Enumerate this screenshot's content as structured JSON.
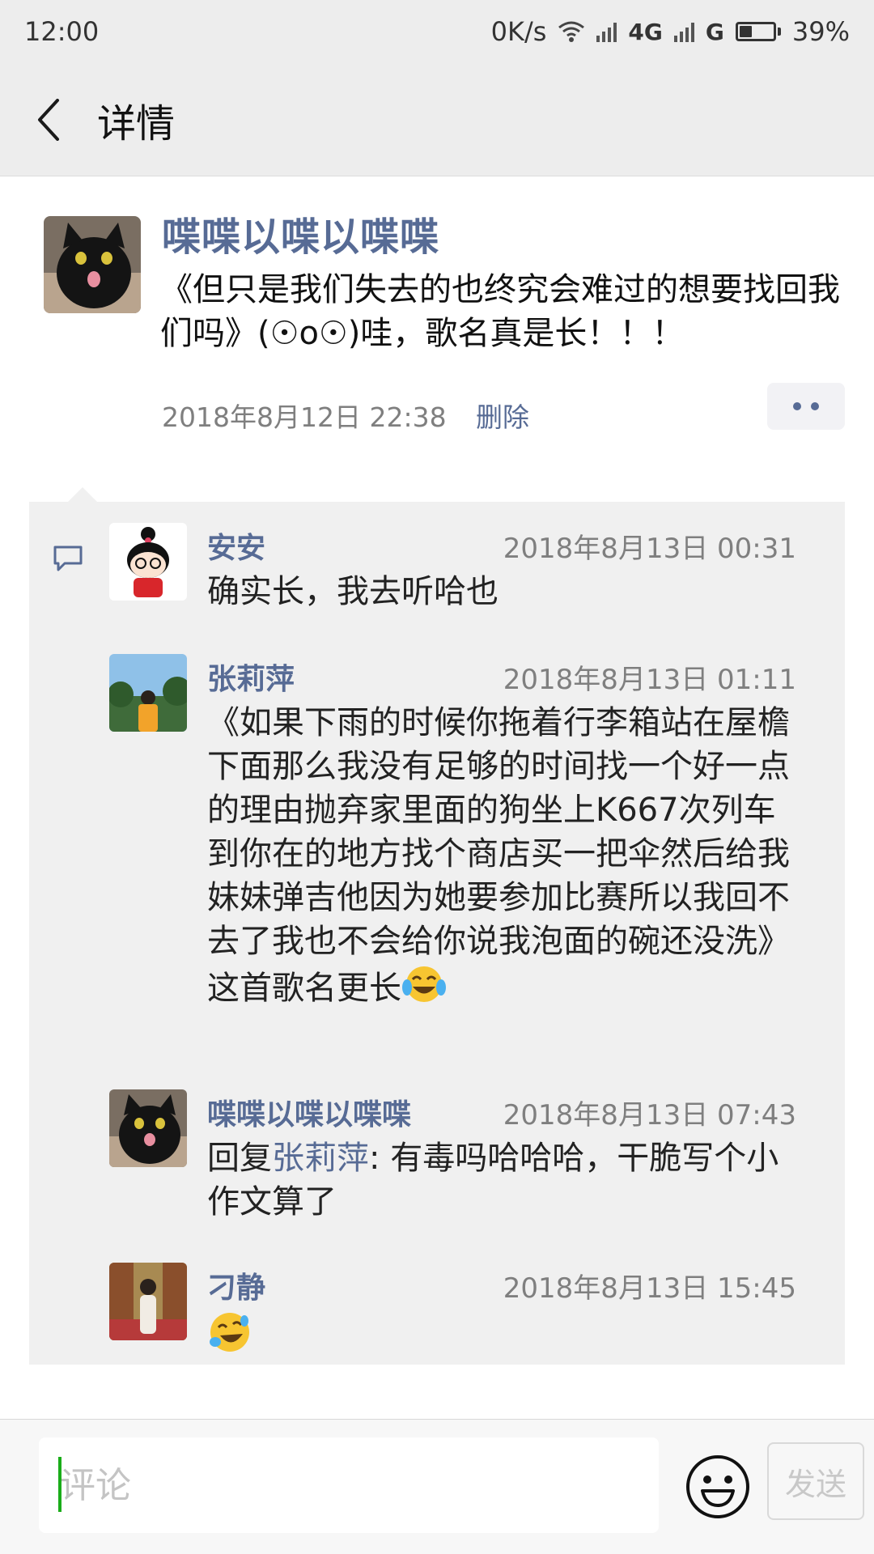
{
  "status": {
    "time": "12:00",
    "speed": "0K/s",
    "network1": "4G",
    "network2": "G",
    "battery": "39%",
    "battery_level": 0.39
  },
  "nav": {
    "title": "详情",
    "back_icon": "chevron-left-icon"
  },
  "post": {
    "author": "喋喋以喋以喋喋",
    "text": "《但只是我们失去的也终究会难过的想要找回我们吗》(☉o☉)哇，歌名真是长！！！",
    "time": "2018年8月12日 22:38",
    "delete_label": "删除"
  },
  "comments": [
    {
      "name": "安安",
      "time": "2018年8月13日 00:31",
      "text": "确实长，我去听哈也"
    },
    {
      "name": "张莉萍",
      "time": "2018年8月13日 01:11",
      "text": "《如果下雨的时候你拖着行李箱站在屋檐下面那么我没有足够的时间找一个好一点的理由抛弃家里面的狗坐上K667次列车到你在的地方找个商店买一把伞然后给我妹妹弹吉他因为她要参加比赛所以我回不去了我也不会给你说我泡面的碗还没洗》这首歌名更长"
    },
    {
      "name": "喋喋以喋以喋喋",
      "time": "2018年8月13日 07:43",
      "reply_prefix": "回复",
      "reply_to": "张莉萍",
      "text": ": 有毒吗哈哈哈，干脆写个小作文算了"
    },
    {
      "name": "刁静",
      "time": "2018年8月13日 15:45",
      "text": ""
    }
  ],
  "input": {
    "placeholder": "评论",
    "send_label": "发送"
  },
  "colors": {
    "link": "#576b95",
    "cursor": "#1aad19"
  }
}
